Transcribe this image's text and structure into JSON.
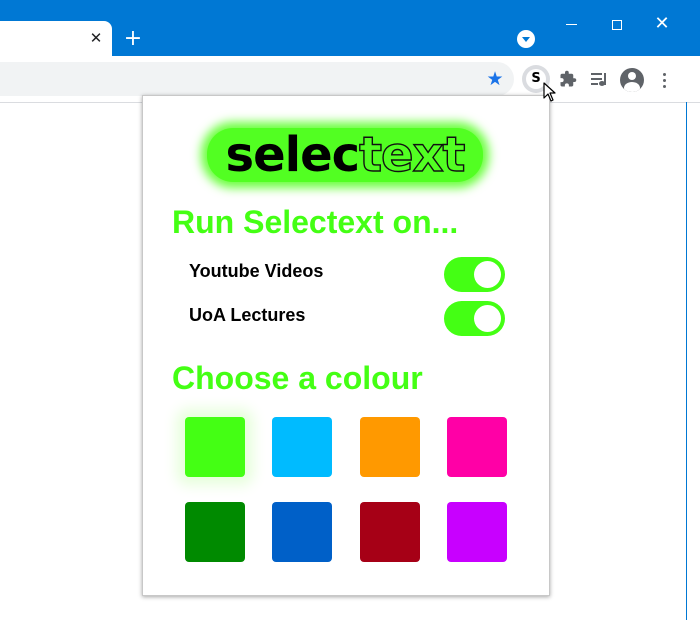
{
  "browser": {
    "tab_close": "✕",
    "new_tab": "+",
    "window_close": "✕",
    "extension_badge": "S"
  },
  "popup": {
    "logo": {
      "part1": "selec",
      "part2": "text"
    },
    "run_heading": "Run Selectext on...",
    "options": [
      {
        "label": "Youtube Videos",
        "enabled": true
      },
      {
        "label": "UoA Lectures",
        "enabled": true
      }
    ],
    "colour_heading": "Choose a colour",
    "colours": [
      "#44ff14",
      "#00bbff",
      "#ff9900",
      "#ff00a6",
      "#008a00",
      "#0060c8",
      "#a60016",
      "#c800ff"
    ],
    "selected_colour_index": 0
  },
  "icons": [
    "chevron-down-icon",
    "minimize-icon",
    "maximize-icon",
    "close-icon",
    "star-icon",
    "puzzle-icon",
    "media-control-icon",
    "profile-icon",
    "more-vert-icon",
    "cursor-icon"
  ]
}
